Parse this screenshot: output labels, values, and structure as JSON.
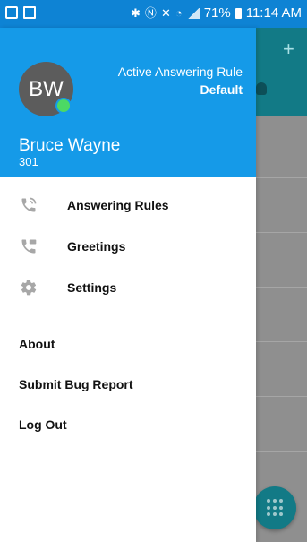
{
  "status_bar": {
    "icons": [
      "app-notification-icon",
      "screenshot-icon",
      "bluetooth-icon",
      "nfc-icon",
      "mute-icon",
      "wifi-icon",
      "signal-icon",
      "battery-icon"
    ],
    "battery": "71%",
    "time": "11:14 AM"
  },
  "drawer": {
    "avatar_initials": "BW",
    "presence_color": "#4cd964",
    "answering_rule_title": "Active Answering Rule",
    "answering_rule_value": "Default",
    "user_name": "Bruce Wayne",
    "user_extension": "301",
    "menu": [
      {
        "label": "Answering Rules",
        "icon": "phone-forward-icon"
      },
      {
        "label": "Greetings",
        "icon": "phone-voicemail-icon"
      },
      {
        "label": "Settings",
        "icon": "gear-icon"
      }
    ],
    "secondary": [
      {
        "label": "About"
      },
      {
        "label": "Submit Bug Report"
      },
      {
        "label": "Log Out"
      }
    ]
  },
  "background": {
    "add_symbol": "+"
  },
  "colors": {
    "status_bar": "#0e83d4",
    "header": "#159ae8",
    "toolbar": "#127a86"
  }
}
